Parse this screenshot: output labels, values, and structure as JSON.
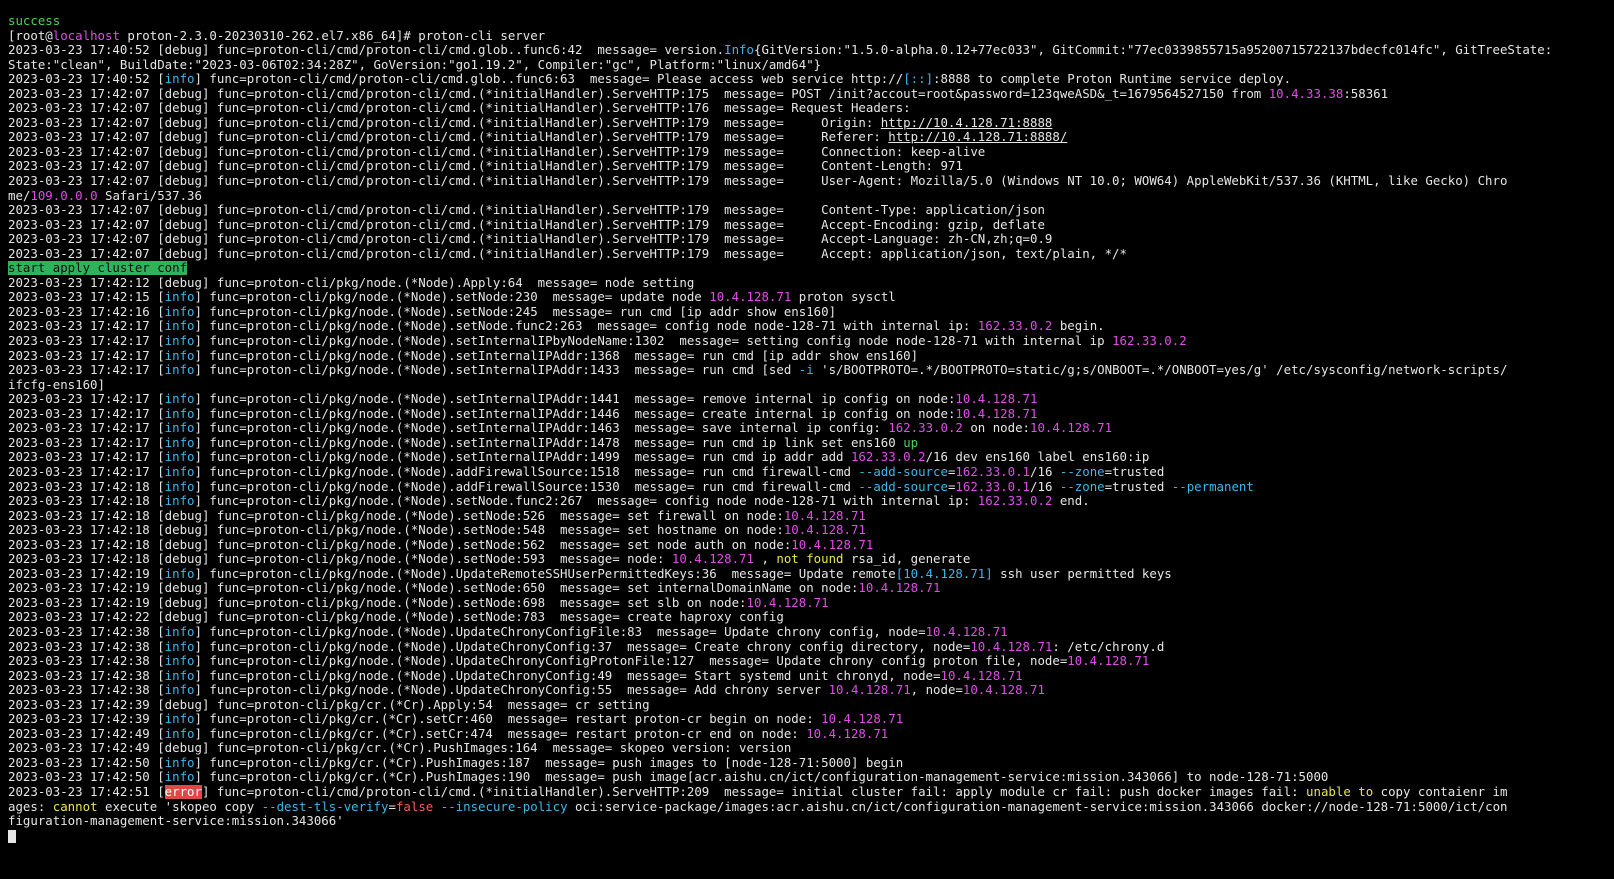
{
  "terminal": {
    "prompt_user": "root",
    "prompt_host": "localhost",
    "cwd": "proton-2.3.0-20230310-262.el7.x86_64",
    "lines": [
      [
        [
          "success",
          "green"
        ]
      ],
      [
        [
          "[root@",
          ""
        ],
        [
          "localhost",
          "magenta"
        ],
        [
          " proton-2.3.0-20230310-262.el7.x86_64]# proton-cli server",
          ""
        ]
      ],
      [
        [
          "2023-03-23 17:40:52 [debug] func=proton-cli/cmd/proton-cli/cmd.glob..func6:42  message= version.",
          ""
        ],
        [
          "Info",
          "cyan"
        ],
        [
          "{GitVersion:\"1.5.0-alpha.0.12+77ec033\", GitCommit:\"77ec0339855715a95200715722137bdecfc014fc\", GitTreeState:",
          ""
        ]
      ],
      [
        [
          "State:\"clean\", BuildDate:\"2023-03-06T02:34:28Z\", GoVersion:\"go1.19.2\", Compiler:\"gc\", Platform:\"linux/amd64\"}",
          ""
        ]
      ],
      [
        [
          "2023-03-23 17:40:52 [",
          ""
        ],
        [
          "info",
          "cyan"
        ],
        [
          "] func=proton-cli/cmd/proton-cli/cmd.glob..func6:63  message= Please access web service http://",
          ""
        ],
        [
          "[::]",
          "cyan"
        ],
        [
          ":8888 to complete Proton Runtime service deploy.",
          ""
        ]
      ],
      [
        [
          "2023-03-23 17:42:07 [debug] func=proton-cli/cmd/proton-cli/cmd.(*initialHandler).ServeHTTP:175  message= POST /init?accout=root&password=123qweASD&_t=1679564527150 from ",
          ""
        ],
        [
          "10.4.33.38",
          "magenta"
        ],
        [
          ":58361",
          ""
        ]
      ],
      [
        [
          "2023-03-23 17:42:07 [debug] func=proton-cli/cmd/proton-cli/cmd.(*initialHandler).ServeHTTP:176  message= Request Headers:",
          ""
        ]
      ],
      [
        [
          "2023-03-23 17:42:07 [debug] func=proton-cli/cmd/proton-cli/cmd.(*initialHandler).ServeHTTP:179  message=     Origin: ",
          ""
        ],
        [
          "http://10.4.128.71:8888",
          "link"
        ]
      ],
      [
        [
          "2023-03-23 17:42:07 [debug] func=proton-cli/cmd/proton-cli/cmd.(*initialHandler).ServeHTTP:179  message=     Referer: ",
          ""
        ],
        [
          "http://10.4.128.71:8888/",
          "link"
        ]
      ],
      [
        [
          "2023-03-23 17:42:07 [debug] func=proton-cli/cmd/proton-cli/cmd.(*initialHandler).ServeHTTP:179  message=     Connection: keep-alive",
          ""
        ]
      ],
      [
        [
          "2023-03-23 17:42:07 [debug] func=proton-cli/cmd/proton-cli/cmd.(*initialHandler).ServeHTTP:179  message=     Content-Length: 971",
          ""
        ]
      ],
      [
        [
          "2023-03-23 17:42:07 [debug] func=proton-cli/cmd/proton-cli/cmd.(*initialHandler).ServeHTTP:179  message=     User-Agent: Mozilla/5.0 (Windows NT 10.0; WOW64) AppleWebKit/537.36 (KHTML, like Gecko) Chro",
          ""
        ]
      ],
      [
        [
          "me/",
          ""
        ],
        [
          "109.0.0.0",
          "magenta"
        ],
        [
          " Safari/537.36",
          ""
        ]
      ],
      [
        [
          "2023-03-23 17:42:07 [debug] func=proton-cli/cmd/proton-cli/cmd.(*initialHandler).ServeHTTP:179  message=     Content-Type: application/json",
          ""
        ]
      ],
      [
        [
          "2023-03-23 17:42:07 [debug] func=proton-cli/cmd/proton-cli/cmd.(*initialHandler).ServeHTTP:179  message=     Accept-Encoding: gzip, deflate",
          ""
        ]
      ],
      [
        [
          "2023-03-23 17:42:07 [debug] func=proton-cli/cmd/proton-cli/cmd.(*initialHandler).ServeHTTP:179  message=     Accept-Language: zh-CN,zh;q=0.9",
          ""
        ]
      ],
      [
        [
          "2023-03-23 17:42:07 [debug] func=proton-cli/cmd/proton-cli/cmd.(*initialHandler).ServeHTTP:179  message=     Accept: application/json, text/plain, */*",
          ""
        ]
      ],
      [
        [
          "start apply cluster conf",
          "hl-green"
        ]
      ],
      [
        [
          "2023-03-23 17:42:12 [debug] func=proton-cli/pkg/node.(*Node).Apply:64  message= node setting",
          ""
        ]
      ],
      [
        [
          "2023-03-23 17:42:15 [",
          ""
        ],
        [
          "info",
          "cyan"
        ],
        [
          "] func=proton-cli/pkg/node.(*Node).setNode:230  message= update node ",
          ""
        ],
        [
          "10.4.128.71",
          "magenta"
        ],
        [
          " proton sysctl",
          ""
        ]
      ],
      [
        [
          "2023-03-23 17:42:16 [",
          ""
        ],
        [
          "info",
          "cyan"
        ],
        [
          "] func=proton-cli/pkg/node.(*Node).setNode:245  message= run cmd [ip addr show ens160]",
          ""
        ]
      ],
      [
        [
          "2023-03-23 17:42:17 [",
          ""
        ],
        [
          "info",
          "cyan"
        ],
        [
          "] func=proton-cli/pkg/node.(*Node).setNode.func2:263  message= config node node-128-71 with internal ip: ",
          ""
        ],
        [
          "162.33.0.2",
          "magenta"
        ],
        [
          " begin.",
          ""
        ]
      ],
      [
        [
          "2023-03-23 17:42:17 [",
          ""
        ],
        [
          "info",
          "cyan"
        ],
        [
          "] func=proton-cli/pkg/node.(*Node).setInternalIPbyNodeName:1302  message= setting config node node-128-71 with internal ip ",
          ""
        ],
        [
          "162.33.0.2",
          "magenta"
        ]
      ],
      [
        [
          "2023-03-23 17:42:17 [",
          ""
        ],
        [
          "info",
          "cyan"
        ],
        [
          "] func=proton-cli/pkg/node.(*Node).setInternalIPAddr:1368  message= run cmd [ip addr show ens160]",
          ""
        ]
      ],
      [
        [
          "2023-03-23 17:42:17 [",
          ""
        ],
        [
          "info",
          "cyan"
        ],
        [
          "] func=proton-cli/pkg/node.(*Node).setInternalIPAddr:1433  message= run cmd [sed ",
          ""
        ],
        [
          "-i",
          "cyan"
        ],
        [
          " 's/BOOTPROTO=.*/BOOTPROTO=static/g;s/ONBOOT=.*/ONBOOT=yes/g' /etc/sysconfig/network-scripts/",
          ""
        ]
      ],
      [
        [
          "ifcfg-ens160]",
          ""
        ]
      ],
      [
        [
          "2023-03-23 17:42:17 [",
          ""
        ],
        [
          "info",
          "cyan"
        ],
        [
          "] func=proton-cli/pkg/node.(*Node).setInternalIPAddr:1441  message= remove internal ip config on node:",
          ""
        ],
        [
          "10.4.128.71",
          "magenta"
        ]
      ],
      [
        [
          "2023-03-23 17:42:17 [",
          ""
        ],
        [
          "info",
          "cyan"
        ],
        [
          "] func=proton-cli/pkg/node.(*Node).setInternalIPAddr:1446  message= create internal ip config on node:",
          ""
        ],
        [
          "10.4.128.71",
          "magenta"
        ]
      ],
      [
        [
          "2023-03-23 17:42:17 [",
          ""
        ],
        [
          "info",
          "cyan"
        ],
        [
          "] func=proton-cli/pkg/node.(*Node).setInternalIPAddr:1463  message= save internal ip config: ",
          ""
        ],
        [
          "162.33.0.2",
          "magenta"
        ],
        [
          " on node:",
          ""
        ],
        [
          "10.4.128.71",
          "magenta"
        ]
      ],
      [
        [
          "2023-03-23 17:42:17 [",
          ""
        ],
        [
          "info",
          "cyan"
        ],
        [
          "] func=proton-cli/pkg/node.(*Node).setInternalIPAddr:1478  message= run cmd ip link set ens160 ",
          ""
        ],
        [
          "up",
          "green"
        ]
      ],
      [
        [
          "2023-03-23 17:42:17 [",
          ""
        ],
        [
          "info",
          "cyan"
        ],
        [
          "] func=proton-cli/pkg/node.(*Node).setInternalIPAddr:1499  message= run cmd ip addr add ",
          ""
        ],
        [
          "162.33.0.2",
          "magenta"
        ],
        [
          "/16 dev ens160 label ens160:ip",
          ""
        ]
      ],
      [
        [
          "2023-03-23 17:42:17 [",
          ""
        ],
        [
          "info",
          "cyan"
        ],
        [
          "] func=proton-cli/pkg/node.(*Node).addFirewallSource:1518  message= run cmd firewall-cmd ",
          ""
        ],
        [
          "--add-source",
          "cyan"
        ],
        [
          "=",
          ""
        ],
        [
          "162.33.0.1",
          "magenta"
        ],
        [
          "/16 ",
          ""
        ],
        [
          "--zone",
          "cyan"
        ],
        [
          "=trusted",
          ""
        ]
      ],
      [
        [
          "2023-03-23 17:42:18 [",
          ""
        ],
        [
          "info",
          "cyan"
        ],
        [
          "] func=proton-cli/pkg/node.(*Node).addFirewallSource:1530  message= run cmd firewall-cmd ",
          ""
        ],
        [
          "--add-source",
          "cyan"
        ],
        [
          "=",
          ""
        ],
        [
          "162.33.0.1",
          "magenta"
        ],
        [
          "/16 ",
          ""
        ],
        [
          "--zone",
          "cyan"
        ],
        [
          "=trusted ",
          ""
        ],
        [
          "--permanent",
          "cyan"
        ]
      ],
      [
        [
          "2023-03-23 17:42:18 [",
          ""
        ],
        [
          "info",
          "cyan"
        ],
        [
          "] func=proton-cli/pkg/node.(*Node).setNode.func2:267  message= config node node-128-71 with internal ip: ",
          ""
        ],
        [
          "162.33.0.2",
          "magenta"
        ],
        [
          " end.",
          ""
        ]
      ],
      [
        [
          "2023-03-23 17:42:18 [debug] func=proton-cli/pkg/node.(*Node).setNode:526  message= set firewall on node:",
          ""
        ],
        [
          "10.4.128.71",
          "magenta"
        ]
      ],
      [
        [
          "2023-03-23 17:42:18 [debug] func=proton-cli/pkg/node.(*Node).setNode:548  message= set hostname on node:",
          ""
        ],
        [
          "10.4.128.71",
          "magenta"
        ]
      ],
      [
        [
          "2023-03-23 17:42:18 [debug] func=proton-cli/pkg/node.(*Node).setNode:562  message= set node auth on node:",
          ""
        ],
        [
          "10.4.128.71",
          "magenta"
        ]
      ],
      [
        [
          "2023-03-23 17:42:18 [debug] func=proton-cli/pkg/node.(*Node).setNode:593  message= node: ",
          ""
        ],
        [
          "10.4.128.71",
          "magenta"
        ],
        [
          " , ",
          ""
        ],
        [
          "not found",
          "yellow"
        ],
        [
          " rsa_id, generate",
          ""
        ]
      ],
      [
        [
          "2023-03-23 17:42:19 [",
          ""
        ],
        [
          "info",
          "cyan"
        ],
        [
          "] func=proton-cli/pkg/node.(*Node).UpdateRemoteSSHUserPermittedKeys:36  message= Update remote",
          ""
        ],
        [
          "[10.4.128.71]",
          "cyan"
        ],
        [
          " ssh user permitted keys",
          ""
        ]
      ],
      [
        [
          "2023-03-23 17:42:19 [debug] func=proton-cli/pkg/node.(*Node).setNode:650  message= set internalDomainName on node:",
          ""
        ],
        [
          "10.4.128.71",
          "magenta"
        ]
      ],
      [
        [
          "2023-03-23 17:42:19 [debug] func=proton-cli/pkg/node.(*Node).setNode:698  message= set slb on node:",
          ""
        ],
        [
          "10.4.128.71",
          "magenta"
        ]
      ],
      [
        [
          "2023-03-23 17:42:22 [debug] func=proton-cli/pkg/node.(*Node).setNode:783  message= create haproxy config",
          ""
        ]
      ],
      [
        [
          "2023-03-23 17:42:38 [",
          ""
        ],
        [
          "info",
          "cyan"
        ],
        [
          "] func=proton-cli/pkg/node.(*Node).UpdateChronyConfigFile:83  message= Update chrony config, node=",
          ""
        ],
        [
          "10.4.128.71",
          "magenta"
        ]
      ],
      [
        [
          "2023-03-23 17:42:38 [",
          ""
        ],
        [
          "info",
          "cyan"
        ],
        [
          "] func=proton-cli/pkg/node.(*Node).UpdateChronyConfig:37  message= Create chrony config directory, node=",
          ""
        ],
        [
          "10.4.128.71",
          "magenta"
        ],
        [
          ": /etc/chrony.d",
          ""
        ]
      ],
      [
        [
          "2023-03-23 17:42:38 [",
          ""
        ],
        [
          "info",
          "cyan"
        ],
        [
          "] func=proton-cli/pkg/node.(*Node).UpdateChronyConfigProtonFile:127  message= Update chrony config proton file, node=",
          ""
        ],
        [
          "10.4.128.71",
          "magenta"
        ]
      ],
      [
        [
          "2023-03-23 17:42:38 [",
          ""
        ],
        [
          "info",
          "cyan"
        ],
        [
          "] func=proton-cli/pkg/node.(*Node).UpdateChronyConfig:49  message= Start systemd unit chronyd, node=",
          ""
        ],
        [
          "10.4.128.71",
          "magenta"
        ]
      ],
      [
        [
          "2023-03-23 17:42:38 [",
          ""
        ],
        [
          "info",
          "cyan"
        ],
        [
          "] func=proton-cli/pkg/node.(*Node).UpdateChronyConfig:55  message= Add chrony server ",
          ""
        ],
        [
          "10.4.128.71",
          "magenta"
        ],
        [
          ", node=",
          ""
        ],
        [
          "10.4.128.71",
          "magenta"
        ]
      ],
      [
        [
          "2023-03-23 17:42:39 [debug] func=proton-cli/pkg/cr.(*Cr).Apply:54  message= cr setting",
          ""
        ]
      ],
      [
        [
          "2023-03-23 17:42:39 [",
          ""
        ],
        [
          "info",
          "cyan"
        ],
        [
          "] func=proton-cli/pkg/cr.(*Cr).setCr:460  message= restart proton-cr begin on node: ",
          ""
        ],
        [
          "10.4.128.71",
          "magenta"
        ]
      ],
      [
        [
          "2023-03-23 17:42:49 [",
          ""
        ],
        [
          "info",
          "cyan"
        ],
        [
          "] func=proton-cli/pkg/cr.(*Cr).setCr:474  message= restart proton-cr end on node: ",
          ""
        ],
        [
          "10.4.128.71",
          "magenta"
        ]
      ],
      [
        [
          "2023-03-23 17:42:49 [debug] func=proton-cli/pkg/cr.(*Cr).PushImages:164  message= skopeo version: version",
          ""
        ]
      ],
      [
        [
          "2023-03-23 17:42:50 [",
          ""
        ],
        [
          "info",
          "cyan"
        ],
        [
          "] func=proton-cli/pkg/cr.(*Cr).PushImages:187  message= push images to [node-128-71:5000] begin",
          ""
        ]
      ],
      [
        [
          "2023-03-23 17:42:50 [",
          ""
        ],
        [
          "info",
          "cyan"
        ],
        [
          "] func=proton-cli/pkg/cr.(*Cr).PushImages:190  message= push image[acr.aishu.cn/ict/configuration-management-service:mission.343066] to node-128-71:5000",
          ""
        ]
      ],
      [
        [
          "2023-03-23 17:42:51 [",
          ""
        ],
        [
          "error",
          "hl-red"
        ],
        [
          "] func=proton-cli/cmd/proton-cli/cmd.(*initialHandler).ServeHTTP:209  message= initial cluster fail: apply module cr fail: push docker images fail: ",
          ""
        ],
        [
          "unable to",
          "yellow"
        ],
        [
          " copy contaienr im",
          ""
        ]
      ],
      [
        [
          "ages: ",
          ""
        ],
        [
          "cannot",
          "yellow"
        ],
        [
          " execute 'skopeo copy ",
          ""
        ],
        [
          "--dest-tls-verify",
          "cyan"
        ],
        [
          "=",
          ""
        ],
        [
          "false",
          "red"
        ],
        [
          " ",
          ""
        ],
        [
          "--insecure-policy",
          "cyan"
        ],
        [
          " oci:service-package/images:acr.aishu.cn/ict/configuration-management-service:mission.343066 docker://node-128-71:5000/ict/con",
          ""
        ]
      ],
      [
        [
          "figuration-management-service:mission.343066'",
          ""
        ]
      ]
    ]
  }
}
